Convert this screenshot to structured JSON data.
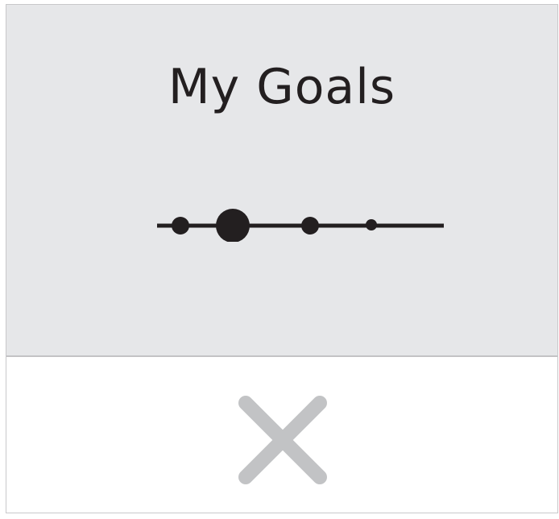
{
  "goals_card": {
    "title": "My Goals"
  },
  "progress": {
    "total_steps": 4,
    "current_step": 2
  },
  "colors": {
    "panel_background": "#e6e7e9",
    "ink": "#231f20",
    "close_icon": "#c2c3c5"
  },
  "close_button": {
    "icon": "close-icon"
  }
}
